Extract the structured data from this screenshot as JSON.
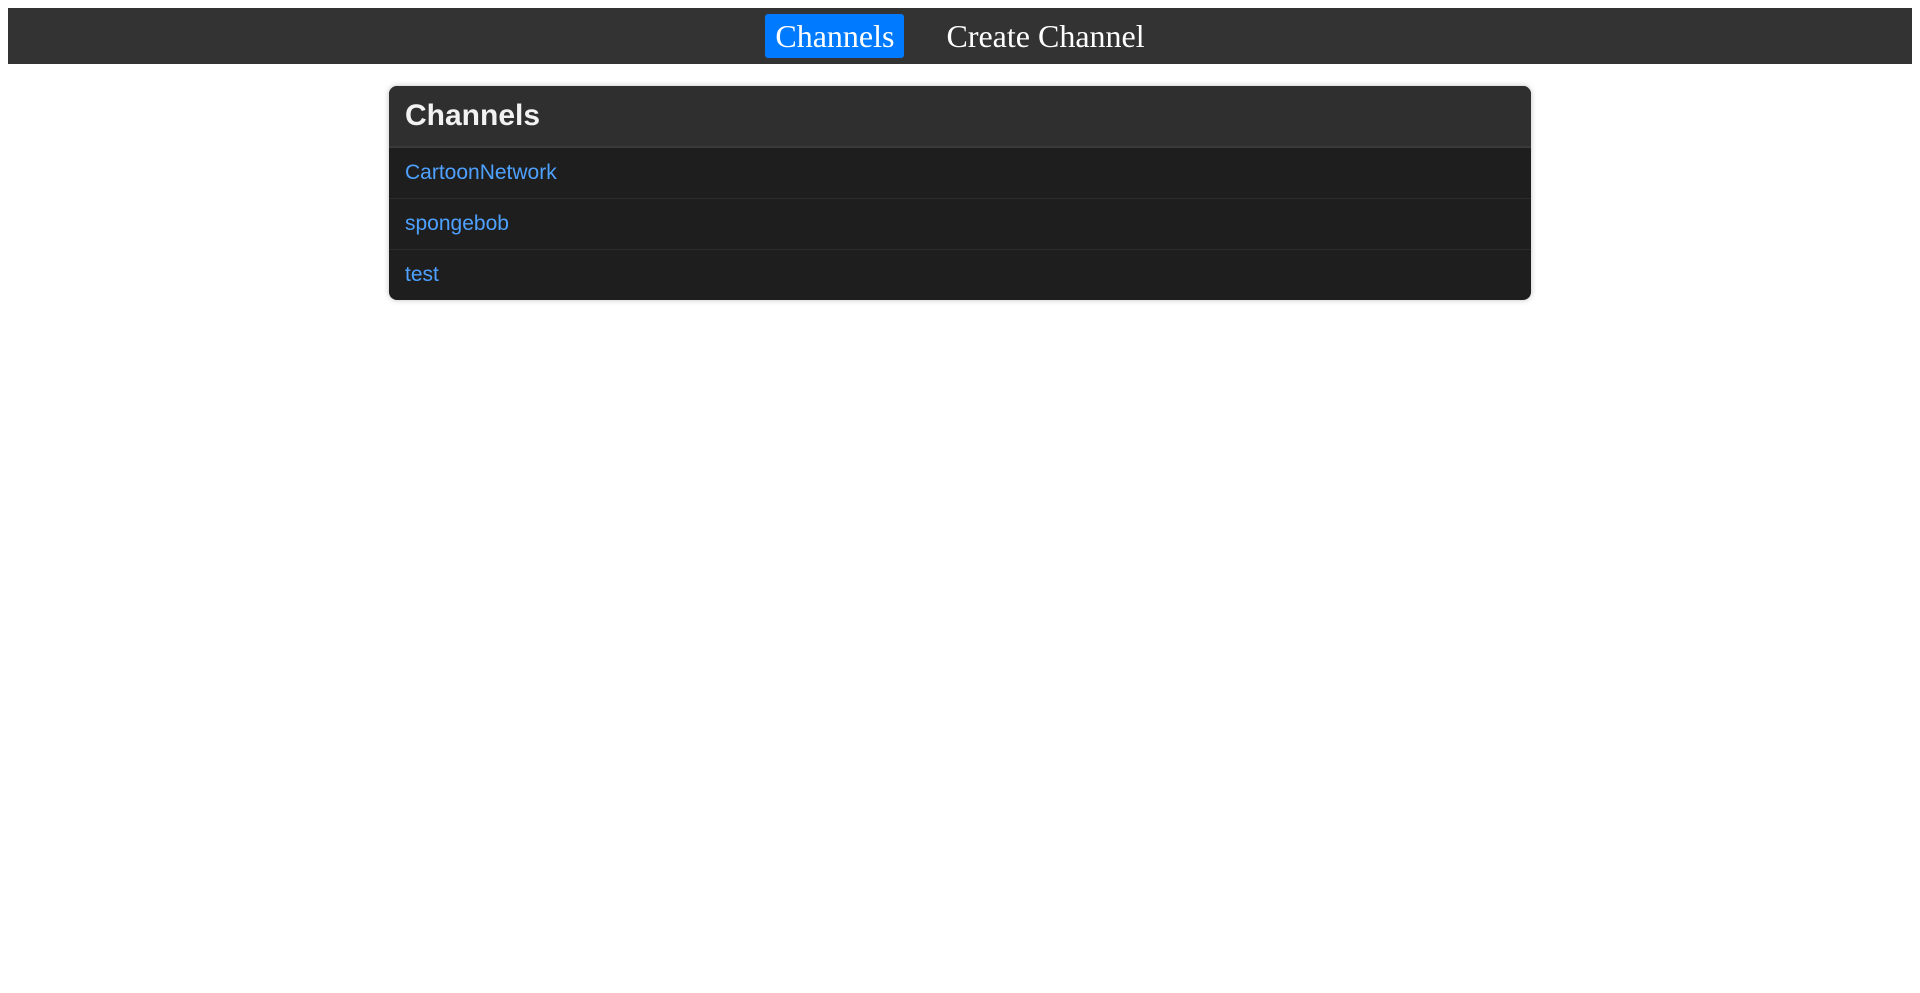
{
  "nav": {
    "items": [
      {
        "label": "Channels",
        "active": true
      },
      {
        "label": "Create Channel",
        "active": false
      }
    ]
  },
  "channels_card": {
    "title": "Channels",
    "items": [
      "CartoonNetwork",
      "spongebob",
      "test"
    ]
  },
  "colors": {
    "nav_bg": "#333333",
    "active_bg": "#007bff",
    "card_bg": "#1e1e1e",
    "link": "#4ea1ff"
  }
}
